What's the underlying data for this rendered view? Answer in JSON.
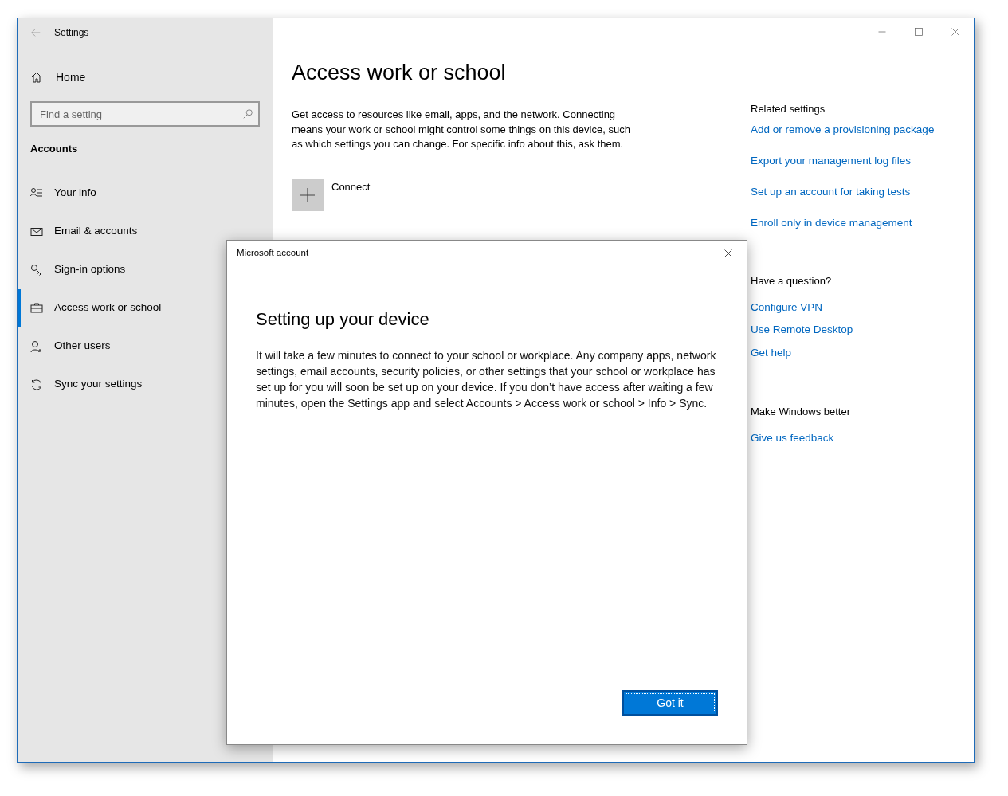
{
  "window": {
    "title": "Settings"
  },
  "sidebar": {
    "home": "Home",
    "search": {
      "placeholder": "Find a setting"
    },
    "section": "Accounts",
    "items": [
      {
        "label": "Your info",
        "selected": false
      },
      {
        "label": "Email & accounts",
        "selected": false
      },
      {
        "label": "Sign-in options",
        "selected": false
      },
      {
        "label": "Access work or school",
        "selected": true
      },
      {
        "label": "Other users",
        "selected": false
      },
      {
        "label": "Sync your settings",
        "selected": false
      }
    ]
  },
  "main": {
    "title": "Access work or school",
    "description": "Get access to resources like email, apps, and the network. Connecting means your work or school might control some things on this device, such as which settings you can change. For specific info about this, ask them.",
    "connect": "Connect"
  },
  "related": [
    {
      "heading": "Related settings",
      "links": [
        "Add or remove a provisioning package",
        "Export your management log files",
        "Set up an account for taking tests",
        "Enroll only in device management"
      ]
    },
    {
      "heading": "Have a question?",
      "links": [
        "Configure VPN",
        "Use Remote Desktop",
        "Get help"
      ]
    },
    {
      "heading": "Make Windows better",
      "links": [
        "Give us feedback"
      ]
    }
  ],
  "dialog": {
    "title": "Microsoft account",
    "heading": "Setting up your device",
    "body": "It will take a few minutes to connect to your school or workplace. Any company apps, network settings, email accounts, security policies, or other settings that your school or workplace has set up for you will soon be set up on your device. If you don’t have access after waiting a few minutes, open the Settings app and select Accounts > Access work or school > Info > Sync.",
    "button": "Got it"
  }
}
